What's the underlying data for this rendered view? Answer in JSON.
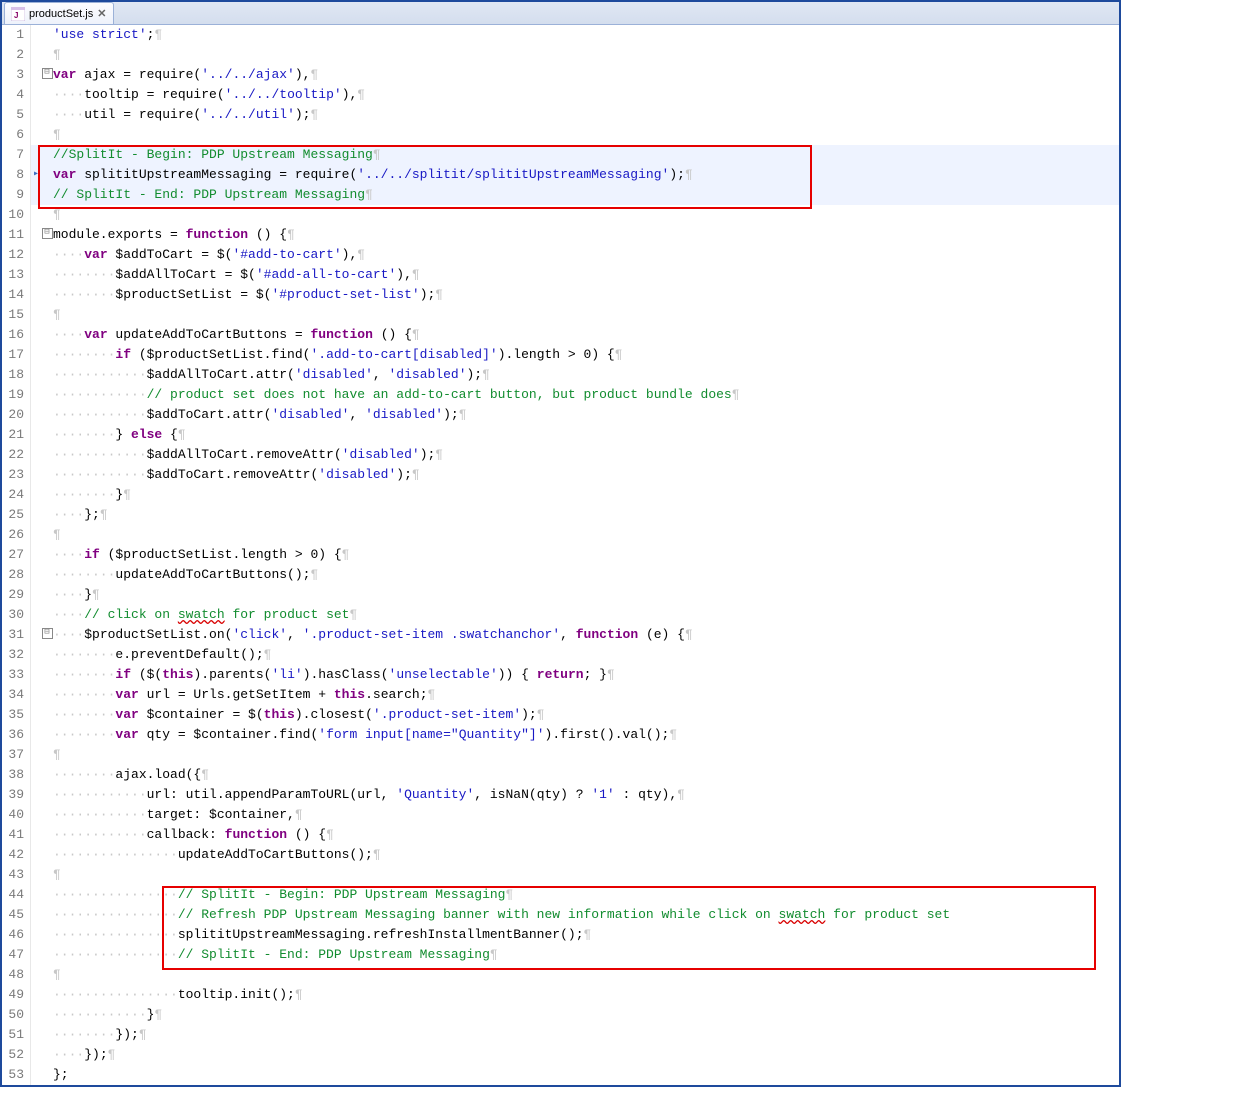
{
  "tab": {
    "filename": "productSet.js",
    "close_glyph": "✕"
  },
  "ws": {
    "dot4": "····",
    "dot8": "········",
    "dot12": "············",
    "dot16": "················",
    "dot20": "····················",
    "para": "¶"
  },
  "fold": {
    "minus": "⊟"
  },
  "lines": {
    "l1": {
      "num": "1",
      "a": "'use strict'",
      "b": ";"
    },
    "l2": {
      "num": "2"
    },
    "l3": {
      "num": "3",
      "kw": "var",
      "a": " ajax = require(",
      "s": "'../../ajax'",
      "b": "),"
    },
    "l4": {
      "num": "4",
      "a": "tooltip = require(",
      "s": "'../../tooltip'",
      "b": "),"
    },
    "l5": {
      "num": "5",
      "a": "util = require(",
      "s": "'../../util'",
      "b": ");"
    },
    "l6": {
      "num": "6"
    },
    "l7": {
      "num": "7",
      "c": "//SplitIt - Begin: PDP Upstream Messaging"
    },
    "l8": {
      "num": "8",
      "kw": "var",
      "a": " splititUpstreamMessaging = require(",
      "s": "'../../splitit/splititUpstreamMessaging'",
      "b": ");"
    },
    "l9": {
      "num": "9",
      "c": "// SplitIt - End: PDP Upstream Messaging"
    },
    "l10": {
      "num": "10"
    },
    "l11": {
      "num": "11",
      "a": "module.exports = ",
      "kw": "function",
      "b": " () {"
    },
    "l12": {
      "num": "12",
      "kw": "var",
      "a": " $addToCart = $(",
      "s": "'#add-to-cart'",
      "b": "),"
    },
    "l13": {
      "num": "13",
      "a": "$addAllToCart = $(",
      "s": "'#add-all-to-cart'",
      "b": "),"
    },
    "l14": {
      "num": "14",
      "a": "$productSetList = $(",
      "s": "'#product-set-list'",
      "b": ");"
    },
    "l15": {
      "num": "15"
    },
    "l16": {
      "num": "16",
      "kw": "var",
      "a": " updateAddToCartButtons = ",
      "kw2": "function",
      "b": " () {"
    },
    "l17": {
      "num": "17",
      "kw": "if",
      "a": " ($productSetList.find(",
      "s": "'.add-to-cart[disabled]'",
      "b": ").length > 0) {"
    },
    "l18": {
      "num": "18",
      "a": "$addAllToCart.attr(",
      "s": "'disabled'",
      "b": ", ",
      "s2": "'disabled'",
      "c": ");"
    },
    "l19": {
      "num": "19",
      "c": "// product set does not have an add-to-cart button, but product bundle does"
    },
    "l20": {
      "num": "20",
      "a": "$addToCart.attr(",
      "s": "'disabled'",
      "b": ", ",
      "s2": "'disabled'",
      "c": ");"
    },
    "l21": {
      "num": "21",
      "a": "} ",
      "kw": "else",
      "b": " {"
    },
    "l22": {
      "num": "22",
      "a": "$addAllToCart.removeAttr(",
      "s": "'disabled'",
      "b": ");"
    },
    "l23": {
      "num": "23",
      "a": "$addToCart.removeAttr(",
      "s": "'disabled'",
      "b": ");"
    },
    "l24": {
      "num": "24",
      "a": "}"
    },
    "l25": {
      "num": "25",
      "a": "};"
    },
    "l26": {
      "num": "26"
    },
    "l27": {
      "num": "27",
      "kw": "if",
      "a": " ($productSetList.length > 0) {"
    },
    "l28": {
      "num": "28",
      "a": "updateAddToCartButtons();"
    },
    "l29": {
      "num": "29",
      "a": "}"
    },
    "l30": {
      "num": "30",
      "c1": "// click on ",
      "err": "swatch",
      "c2": " for product set"
    },
    "l31": {
      "num": "31",
      "a": "$productSetList.on(",
      "s": "'click'",
      "b": ", ",
      "s2": "'.product-set-item .swatchanchor'",
      "c": ", ",
      "kw": "function",
      "d": " (e) {"
    },
    "l32": {
      "num": "32",
      "a": "e.preventDefault();"
    },
    "l33": {
      "num": "33",
      "kw": "if",
      "a": " ($(",
      "kw2": "this",
      "b": ").parents(",
      "s": "'li'",
      "c": ").hasClass(",
      "s2": "'unselectable'",
      "d": ")) { ",
      "kw3": "return",
      "e": "; }"
    },
    "l34": {
      "num": "34",
      "kw": "var",
      "a": " url = Urls.getSetItem + ",
      "kw2": "this",
      "b": ".search;"
    },
    "l35": {
      "num": "35",
      "kw": "var",
      "a": " $container = $(",
      "kw2": "this",
      "b": ").closest(",
      "s": "'.product-set-item'",
      "c": ");"
    },
    "l36": {
      "num": "36",
      "kw": "var",
      "a": " qty = $container.find(",
      "s": "'form input[name=\"Quantity\"]'",
      "b": ").first().val();"
    },
    "l37": {
      "num": "37"
    },
    "l38": {
      "num": "38",
      "a": "ajax.load({"
    },
    "l39": {
      "num": "39",
      "a": "url: util.appendParamToURL(url, ",
      "s": "'Quantity'",
      "b": ", isNaN(qty) ? ",
      "s2": "'1'",
      "c": " : qty),"
    },
    "l40": {
      "num": "40",
      "a": "target: $container,"
    },
    "l41": {
      "num": "41",
      "a": "callback: ",
      "kw": "function",
      "b": " () {"
    },
    "l42": {
      "num": "42",
      "a": "updateAddToCartButtons();"
    },
    "l43": {
      "num": "43"
    },
    "l44": {
      "num": "44",
      "c": "// SplitIt - Begin: PDP Upstream Messaging"
    },
    "l45": {
      "num": "45",
      "c1": "// Refresh PDP Upstream Messaging banner with new information while click on ",
      "err": "swatch",
      "c2": " for product set"
    },
    "l46": {
      "num": "46",
      "a": "splititUpstreamMessaging.refreshInstallmentBanner();"
    },
    "l47": {
      "num": "47",
      "c": "// SplitIt - End: PDP Upstream Messaging"
    },
    "l48": {
      "num": "48"
    },
    "l49": {
      "num": "49",
      "a": "tooltip.init();"
    },
    "l50": {
      "num": "50",
      "a": "}"
    },
    "l51": {
      "num": "51",
      "a": "});"
    },
    "l52": {
      "num": "52",
      "a": "});"
    },
    "l53": {
      "num": "53",
      "a": "};"
    }
  }
}
